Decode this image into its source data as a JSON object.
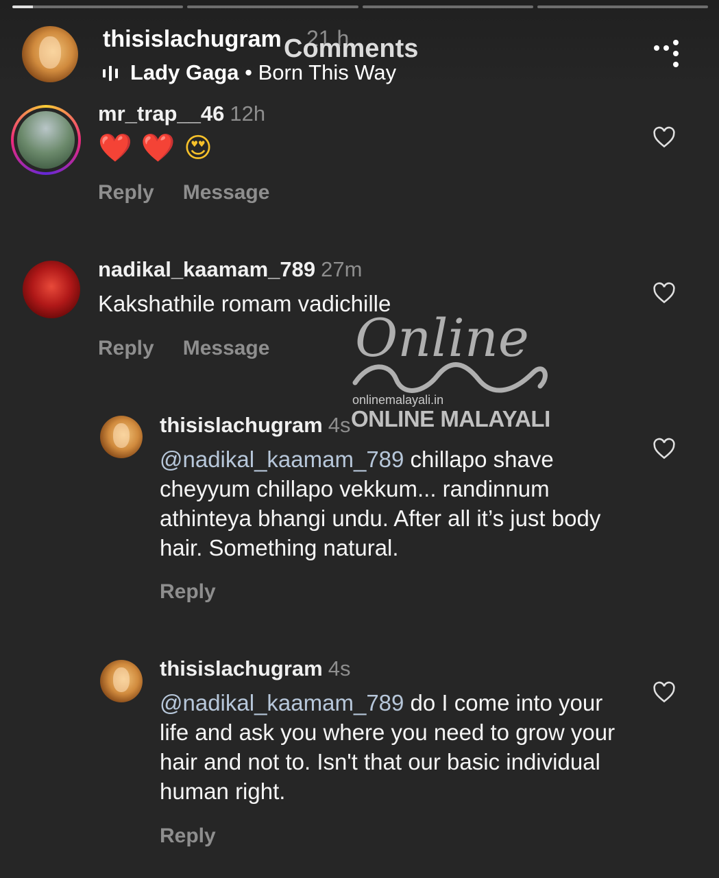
{
  "header": {
    "username": "thisislachugram",
    "time": "21 h",
    "title": "Comments",
    "music_artist": "Lady Gaga",
    "music_separator": "•",
    "music_track": "Born This Way",
    "more_icon": "more-vertical-icon"
  },
  "progress_segments": 4,
  "comments": [
    {
      "username": "mr_trap__46",
      "time": "12h",
      "emojis": [
        "❤️",
        "❤️",
        "😍"
      ],
      "reply_label": "Reply",
      "message_label": "Message"
    },
    {
      "username": "nadikal_kaamam_789",
      "time": "27m",
      "text": "Kakshathile romam vadichille",
      "reply_label": "Reply",
      "message_label": "Message"
    }
  ],
  "replies": [
    {
      "username": "thisislachugram",
      "time": "4s",
      "mention": "@nadikal_kaamam_789",
      "text": " chillapo shave cheyyum chillapo vekkum... randinnum athinteya bhangi undu. After all it’s just body hair. Something natural.",
      "reply_label": "Reply"
    },
    {
      "username": "thisislachugram",
      "time": "4s",
      "mention": "@nadikal_kaamam_789",
      "text": " do I come into your life and ask you where you need to grow your hair and not to. Isn't that our basic individual human right.",
      "reply_label": "Reply"
    }
  ],
  "watermark": {
    "script_text": "Online",
    "url": "onlinemalayali.in",
    "name": "ONLINE MALAYALI"
  },
  "colors": {
    "background": "#262626",
    "muted": "#8e8e8e",
    "mention": "#b7c7da"
  }
}
